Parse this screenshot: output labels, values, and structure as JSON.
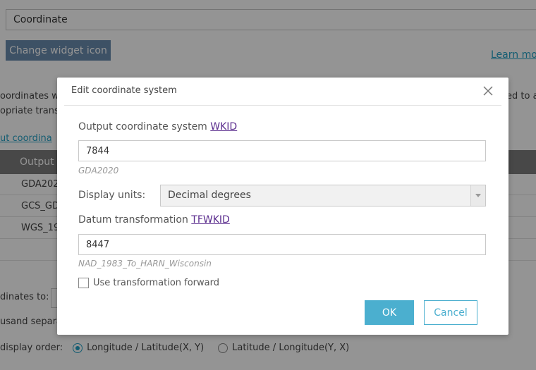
{
  "background": {
    "widget_name_value": "Coordinate",
    "change_icon_label": "Change widget icon",
    "learn_more_label": "Learn mor",
    "desc_line1": "oordinates wi",
    "desc_line2": "opriate transf",
    "desc_right": "ed to a",
    "output_link": "ut coordina",
    "table_header": "Output c",
    "table_rows": [
      "GDA202",
      "GCS_GD",
      "WGS_19"
    ],
    "coords_to_label": "dinates to:",
    "thousand_sep_label": "usand separa",
    "display_order_label": "display order:",
    "radio_lonlat": "Longitude / Latitude(X, Y)",
    "radio_latlon": "Latitude / Longitude(Y, X)"
  },
  "dialog": {
    "title": "Edit coordinate system",
    "output_label": "Output coordinate system",
    "output_link": "WKID",
    "output_value": "7844",
    "output_hint": "GDA2020",
    "units_label": "Display units:",
    "units_value": "Decimal degrees",
    "datum_label": "Datum transformation",
    "datum_link": "TFWKID",
    "datum_value": "8447",
    "datum_hint": "NAD_1983_To_HARN_Wisconsin",
    "forward_label": "Use transformation forward",
    "ok_label": "OK",
    "cancel_label": "Cancel"
  },
  "colors": {
    "accent": "#4bafcf",
    "link": "#5b2d8e",
    "overlay": "#000000"
  }
}
